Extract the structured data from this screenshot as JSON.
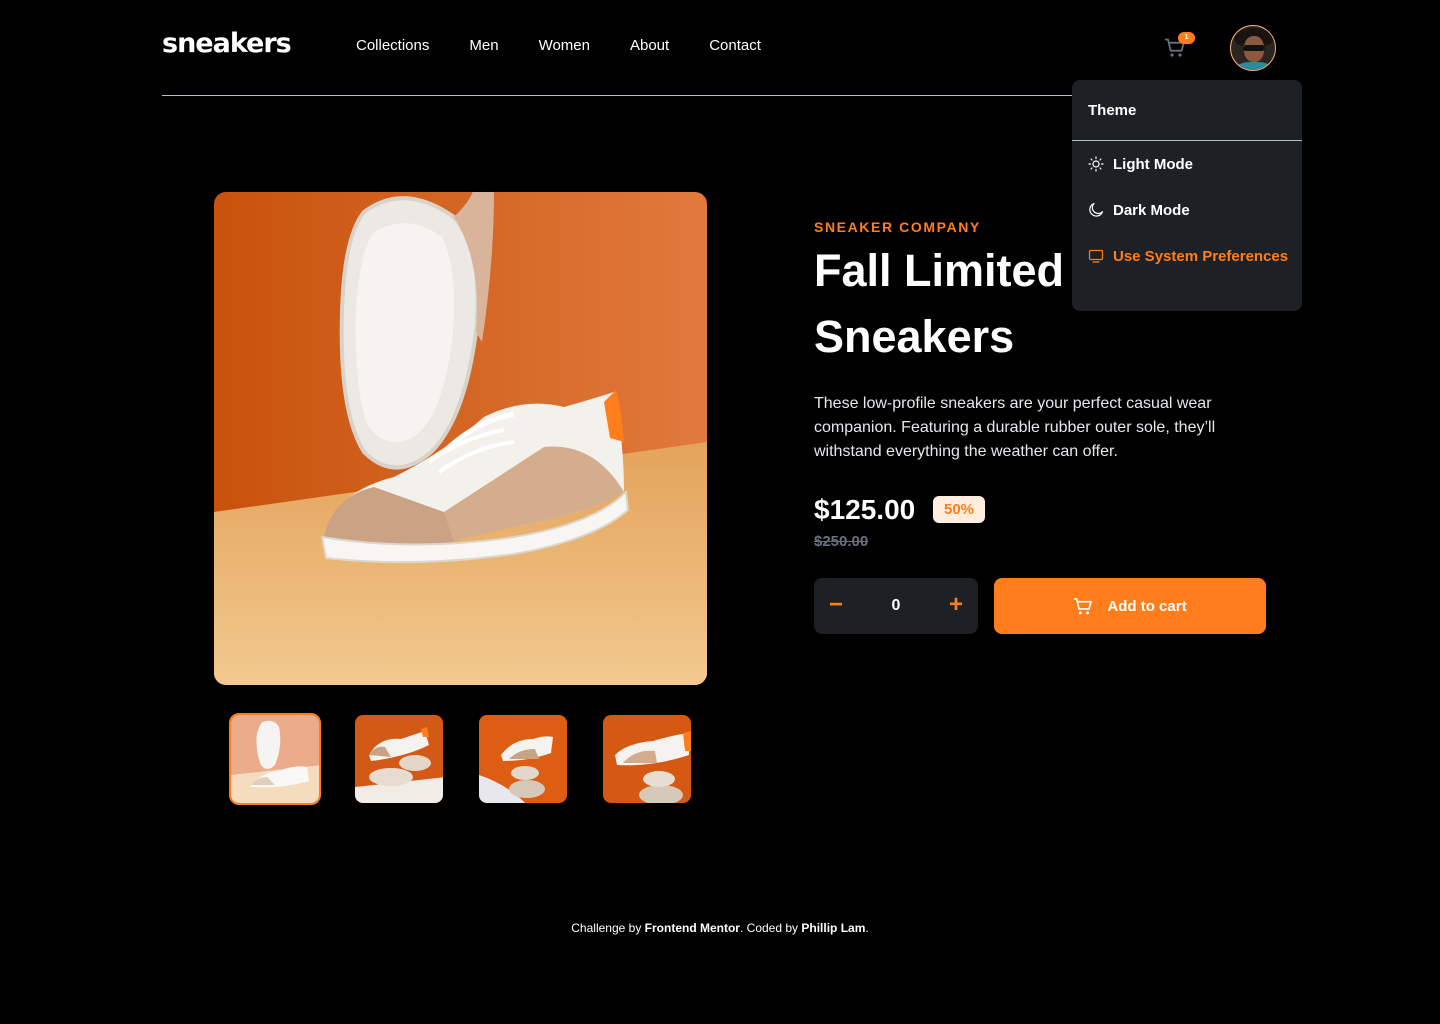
{
  "brand": {
    "logo": "sneakers"
  },
  "nav": {
    "items": [
      "Collections",
      "Men",
      "Women",
      "About",
      "Contact"
    ]
  },
  "cart": {
    "count": "1"
  },
  "theme_menu": {
    "title": "Theme",
    "items": [
      {
        "label": "Light Mode",
        "icon": "sun-icon",
        "active": false
      },
      {
        "label": "Dark Mode",
        "icon": "moon-icon",
        "active": false
      },
      {
        "label": "Use System Preferences",
        "icon": "monitor-icon",
        "active": true
      }
    ]
  },
  "gallery": {
    "main": "sneaker-product-1",
    "thumbnails": [
      "sneaker-product-1",
      "sneaker-product-2",
      "sneaker-product-3",
      "sneaker-product-4"
    ],
    "active_index": 0
  },
  "product": {
    "company": "SNEAKER COMPANY",
    "title": "Fall Limited Edition Sneakers",
    "description": "These low-profile sneakers are your perfect casual wear companion. Featuring a durable rubber outer sole, they’ll withstand everything the weather can offer.",
    "price": "$125.00",
    "discount": "50%",
    "original_price": "$250.00",
    "quantity": "0",
    "minus": "−",
    "plus": "+",
    "add_to_cart": "Add to cart"
  },
  "footer": {
    "prefix": "Challenge by ",
    "mentor": "Frontend Mentor",
    "middle": ". Coded by ",
    "author": "Phillip Lam",
    "suffix": "."
  },
  "colors": {
    "accent": "#ff7e1b",
    "background": "#000000",
    "panel": "#1d2025",
    "discount_bg": "#ffede0",
    "muted": "#69707d"
  }
}
